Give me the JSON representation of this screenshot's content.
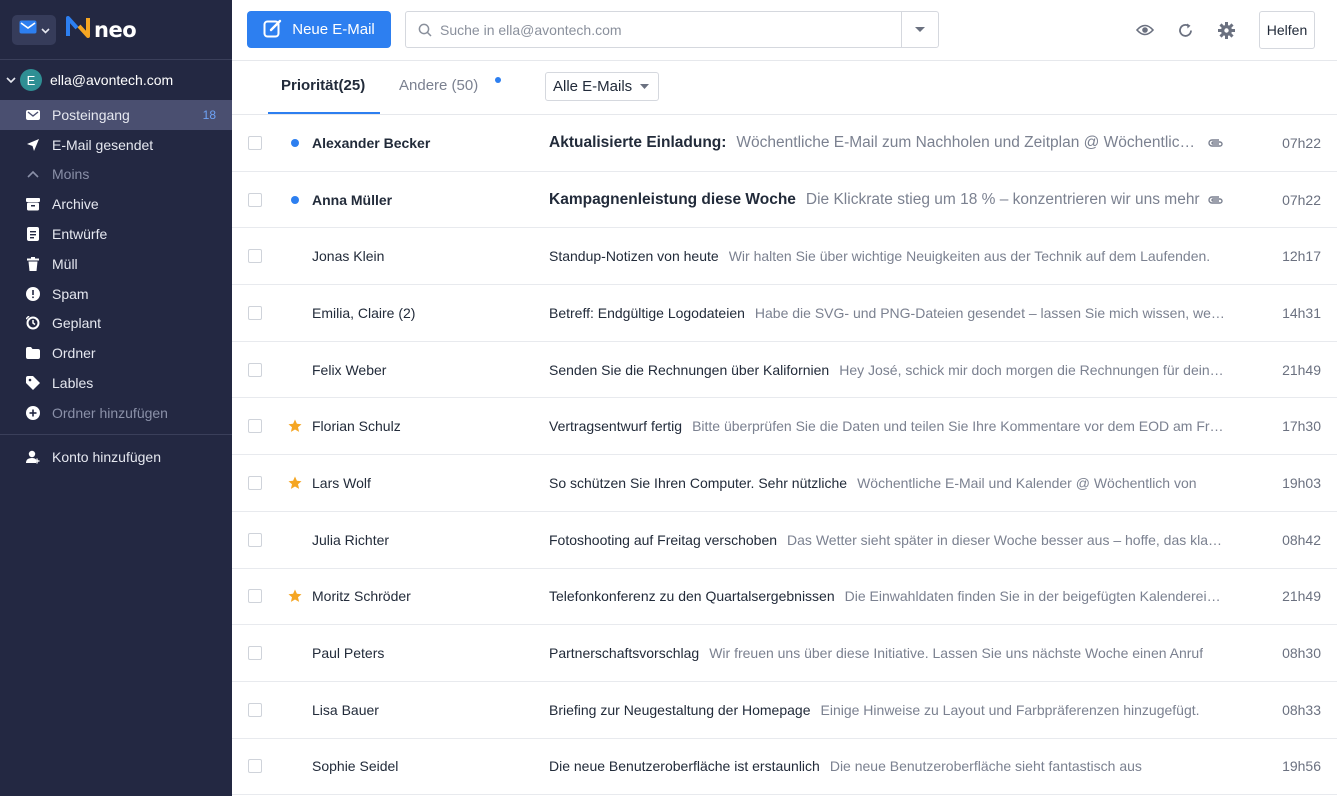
{
  "app": {
    "name": "neo",
    "colors": {
      "sidebar": "#232842",
      "accent": "#2d7ff0",
      "star": "#f5a623"
    }
  },
  "account": {
    "initial": "E",
    "email": "ella@avontech.com"
  },
  "sidebar": {
    "items": [
      {
        "label": "Posteingang",
        "icon": "inbox-icon",
        "count": "18",
        "active": true
      },
      {
        "label": "E-Mail gesendet",
        "icon": "send-icon"
      },
      {
        "label": "Moins",
        "icon": "chevron-up-icon"
      },
      {
        "label": "Archive",
        "icon": "archive-icon"
      },
      {
        "label": "Entwürfe",
        "icon": "drafts-icon"
      },
      {
        "label": "Müll",
        "icon": "trash-icon"
      },
      {
        "label": "Spam",
        "icon": "spam-icon"
      },
      {
        "label": "Geplant",
        "icon": "scheduled-icon"
      },
      {
        "label": "Ordner",
        "icon": "folder-icon"
      },
      {
        "label": "Lables",
        "icon": "label-icon"
      },
      {
        "label": "Ordner hinzufügen",
        "icon": "add-circle-icon"
      }
    ],
    "add_account": "Konto hinzufügen"
  },
  "header": {
    "compose_label": "Neue E-Mail",
    "search_placeholder": "Suche in ella@avontech.com",
    "help_label": "Helfen"
  },
  "tabs": {
    "priority": "Priorität(25)",
    "other": "Andere (50)",
    "filter": "Alle E-Mails"
  },
  "emails": [
    {
      "sender": "Alexander Becker",
      "subject": "Aktualisierte Einladung:",
      "preview": "Wöchentliche E-Mail zum Nachholen und Zeitplan @ Wöchentlich von",
      "time": "07h22",
      "unread": true,
      "attachment": true
    },
    {
      "sender": "Anna Müller",
      "subject": "Kampagnenleistung diese Woche",
      "preview": "Die Klickrate stieg um 18 % – konzentrieren wir uns mehr",
      "time": "07h22",
      "unread": true,
      "attachment": true
    },
    {
      "sender": "Jonas Klein",
      "subject": "Standup-Notizen von heute",
      "preview": "Wir halten Sie über wichtige Neuigkeiten aus der Technik auf dem Laufenden.",
      "time": "12h17"
    },
    {
      "sender": "Emilia, Claire (2)",
      "subject": "Betreff: Endgültige Logodateien",
      "preview": "Habe die SVG- und PNG-Dateien gesendet – lassen Sie mich wissen, wenn Sie",
      "time": "14h31"
    },
    {
      "sender": "Felix Weber",
      "subject": "Senden Sie die Rechnungen über Kalifornien",
      "preview": "Hey José, schick mir doch morgen die Rechnungen für deine Reise",
      "time": "21h49"
    },
    {
      "sender": "Florian Schulz",
      "subject": "Vertragsentwurf fertig",
      "preview": "Bitte überprüfen Sie die Daten und teilen Sie Ihre Kommentare vor dem EOD am Freitag",
      "time": "17h30",
      "starred": true
    },
    {
      "sender": "Lars Wolf",
      "subject": "So schützen Sie Ihren Computer. Sehr nützliche",
      "preview": "Wöchentliche E-Mail und Kalender @ Wöchentlich von",
      "time": "19h03",
      "starred": true
    },
    {
      "sender": "Julia Richter",
      "subject": "Fotoshooting auf Freitag verschoben",
      "preview": "Das Wetter sieht später in dieser Woche besser aus – hoffe, das klappt.",
      "time": "08h42"
    },
    {
      "sender": "Moritz Schröder",
      "subject": "Telefonkonferenz zu den Quartalsergebnissen",
      "preview": "Die Einwahldaten finden Sie in der beigefügten Kalendereinladung",
      "time": "21h49",
      "starred": true
    },
    {
      "sender": "Paul Peters",
      "subject": "Partnerschaftsvorschlag",
      "preview": "Wir freuen uns über diese Initiative. Lassen Sie uns nächste Woche einen Anruf",
      "time": "08h30"
    },
    {
      "sender": "Lisa Bauer",
      "subject": "Briefing zur Neugestaltung der Homepage",
      "preview": "Einige Hinweise zu Layout und Farbpräferenzen hinzugefügt.",
      "time": "08h33"
    },
    {
      "sender": "Sophie Seidel",
      "subject": "Die neue Benutzeroberfläche ist erstaunlich",
      "preview": "Die neue Benutzeroberfläche sieht fantastisch aus",
      "time": "19h56"
    }
  ]
}
